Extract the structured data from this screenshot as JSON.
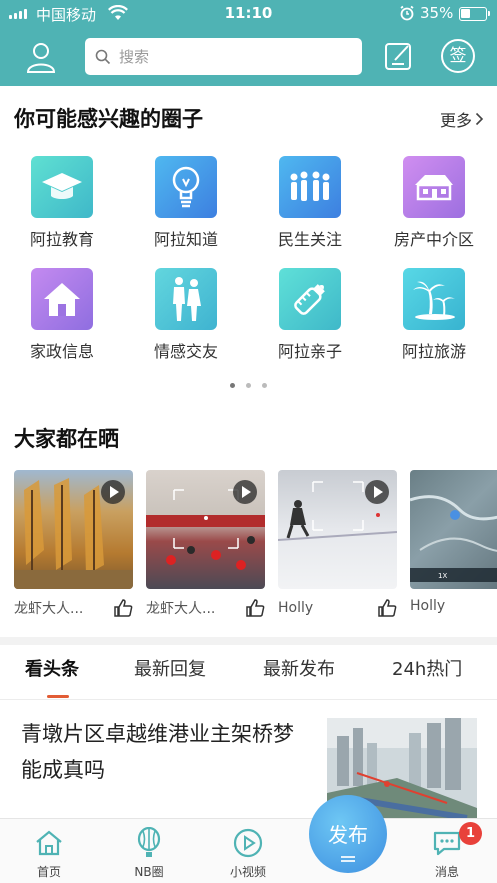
{
  "status_bar": {
    "carrier": "中国移动",
    "time": "11:10",
    "battery": "35%"
  },
  "header": {
    "search_placeholder": "搜索",
    "sign_label": "签"
  },
  "circles": {
    "title": "你可能感兴趣的圈子",
    "more": "更多",
    "items": [
      {
        "label": "阿拉教育",
        "icon": "graduation-cap-icon",
        "color": "#4fd0c8"
      },
      {
        "label": "阿拉知道",
        "icon": "lightbulb-icon",
        "color": "#4a9bea"
      },
      {
        "label": "民生关注",
        "icon": "people-icon",
        "color": "#4a9bea"
      },
      {
        "label": "房产中介区",
        "icon": "house-icon",
        "color": "#b67fe0"
      },
      {
        "label": "家政信息",
        "icon": "home-icon",
        "color": "#a87be0"
      },
      {
        "label": "情感交友",
        "icon": "couple-icon",
        "color": "#52c7d6"
      },
      {
        "label": "阿拉亲子",
        "icon": "baby-bottle-icon",
        "color": "#4ad0d6"
      },
      {
        "label": "阿拉旅游",
        "icon": "palm-tree-icon",
        "color": "#40c9d8"
      }
    ]
  },
  "videos": {
    "title": "大家都在晒",
    "items": [
      {
        "author": "龙虾大人...",
        "scene": "autumn-trees"
      },
      {
        "author": "龙虾大人...",
        "scene": "basketball-court"
      },
      {
        "author": "Holly",
        "scene": "ski-slope"
      },
      {
        "author": "Holly",
        "scene": "map"
      }
    ]
  },
  "tabs": {
    "items": [
      "看头条",
      "最新回复",
      "最新发布",
      "24h热门"
    ],
    "active": "看头条"
  },
  "news": {
    "title": "青墩片区卓越维港业主架桥梦能成真吗"
  },
  "bottom_nav": {
    "items": [
      {
        "label": "首页",
        "icon": "home-icon"
      },
      {
        "label": "NB圈",
        "icon": "balloon-icon"
      },
      {
        "label": "小视频",
        "icon": "play-circle-icon"
      },
      {
        "label": "消息",
        "icon": "chat-icon"
      }
    ],
    "publish": "发布",
    "message_badge": "1"
  },
  "colors": {
    "brand": "#4fb3b4",
    "accent": "#e25c35",
    "badge": "#e8413a"
  }
}
